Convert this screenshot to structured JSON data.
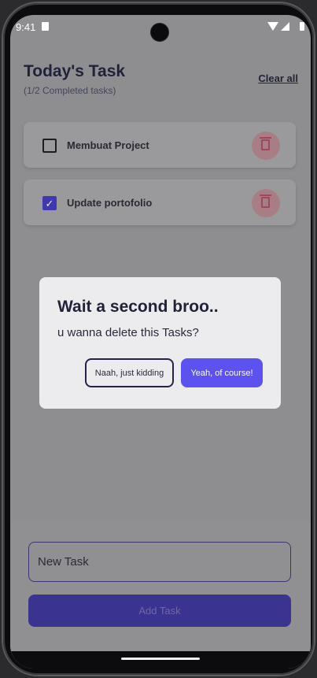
{
  "status_bar": {
    "time": "9:41"
  },
  "header": {
    "title": "Today's Task",
    "subtitle": "(1/2 Completed tasks)",
    "clear_all": "Clear all"
  },
  "tasks": [
    {
      "label": "Membuat Project",
      "completed": false
    },
    {
      "label": "Update portofolio",
      "completed": true
    }
  ],
  "dialog": {
    "title": "Wait a second broo..",
    "message": "u wanna delete this Tasks?",
    "cancel_label": "Naah, just kidding",
    "confirm_label": "Yeah, of course!"
  },
  "bottom": {
    "input_placeholder": "New Task",
    "input_value": "",
    "add_label": "Add Task"
  },
  "colors": {
    "accent": "#5b52ef",
    "add_button": "#3a3490",
    "delete_tint": "#a0465e"
  }
}
